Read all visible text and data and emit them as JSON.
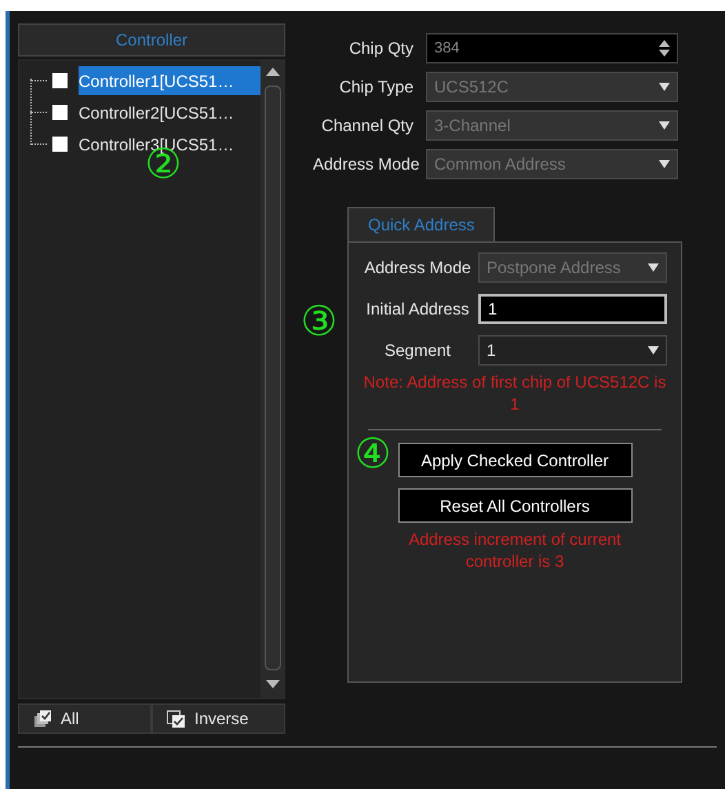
{
  "controller_panel": {
    "header": "Controller",
    "items": [
      {
        "label": "Controller1[UCS51…",
        "checked": false,
        "selected": true
      },
      {
        "label": "Controller2[UCS51…",
        "checked": false,
        "selected": false
      },
      {
        "label": "Controller3[UCS51…",
        "checked": false,
        "selected": false
      }
    ],
    "buttons": [
      {
        "label": "All",
        "kind": "all"
      },
      {
        "label": "Inverse",
        "kind": "inverse"
      }
    ]
  },
  "settings": [
    {
      "label": "Chip Qty",
      "kind": "spin",
      "value": "384"
    },
    {
      "label": "Chip Type",
      "kind": "select",
      "value": "UCS512C"
    },
    {
      "label": "Channel Qty",
      "kind": "select",
      "value": "3-Channel"
    },
    {
      "label": "Address Mode",
      "kind": "select",
      "value": "Common Address"
    }
  ],
  "quick_address": {
    "tab": "Quick Address",
    "fields": [
      {
        "label": "Address Mode",
        "kind": "disabled_select",
        "value": "Postpone Address"
      },
      {
        "label": "Initial Address",
        "kind": "input",
        "value": "1"
      },
      {
        "label": "Segment",
        "kind": "select",
        "value": "1"
      }
    ],
    "note": "Note: Address of first chip of UCS512C is 1",
    "buttons": [
      "Apply Checked Controller",
      "Reset All Controllers"
    ],
    "increment_note": "Address increment of current controller is 3"
  },
  "annotations": [
    "②",
    "③",
    "④"
  ]
}
